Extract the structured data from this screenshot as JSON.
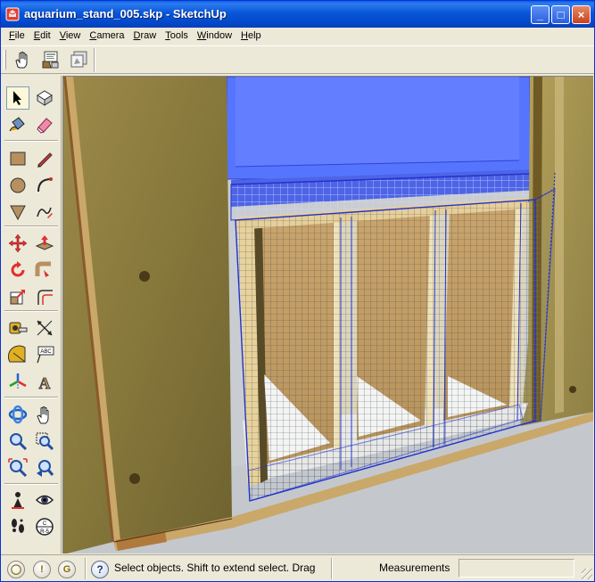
{
  "window": {
    "title": "aquarium_stand_005.skp - SketchUp",
    "min_symbol": "_",
    "max_symbol": "□",
    "close_symbol": "×"
  },
  "menu": [
    {
      "label": "File",
      "u": "F",
      "rest": "ile"
    },
    {
      "label": "Edit",
      "u": "E",
      "rest": "dit"
    },
    {
      "label": "View",
      "u": "V",
      "rest": "iew"
    },
    {
      "label": "Camera",
      "u": "C",
      "rest": "amera"
    },
    {
      "label": "Draw",
      "u": "D",
      "rest": "raw"
    },
    {
      "label": "Tools",
      "u": "T",
      "rest": "ools"
    },
    {
      "label": "Window",
      "u": "W",
      "rest": "indow"
    },
    {
      "label": "Help",
      "u": "H",
      "rest": "elp"
    }
  ],
  "top_toolbar": {
    "icons": [
      "hand-pointer-icon",
      "instructor-icon",
      "component-browser-icon"
    ]
  },
  "left_toolbar": {
    "icons": [
      "select-arrow-icon",
      "make-component-icon",
      "paint-bucket-icon",
      "eraser-icon",
      "rectangle-icon",
      "pencil-line-icon",
      "circle-icon",
      "arc-icon",
      "polygon-icon",
      "freehand-icon",
      "move-icon",
      "push-pull-icon",
      "rotate-icon",
      "follow-me-icon",
      "scale-icon",
      "offset-icon",
      "tape-measure-icon",
      "dimension-icon",
      "protractor-icon",
      "text-label-icon",
      "axes-icon",
      "3d-text-icon",
      "orbit-icon",
      "pan-hand-icon",
      "zoom-icon",
      "zoom-window-icon",
      "zoom-extents-icon",
      "previous-view-icon",
      "position-camera-icon",
      "look-around-icon",
      "walk-icon",
      "section-plane-icon"
    ],
    "text_label_glyph": "ABC",
    "text_3d_glyph": "A"
  },
  "status_bar": {
    "geo_icon_1": "◯",
    "geo_icon_2": "!",
    "geo_icon_3": "G",
    "help_glyph": "?",
    "status_text": "Select objects. Shift to extend select. Drag",
    "measurements_label": "Measurements",
    "measurements_value": ""
  },
  "colors": {
    "titlebar": "#0856d8",
    "chrome": "#ece9d8",
    "plywood": "#b8a055",
    "glass_blue": "#5577ff",
    "selection_blue": "#2233cc",
    "sky": "#c8cdd3"
  }
}
